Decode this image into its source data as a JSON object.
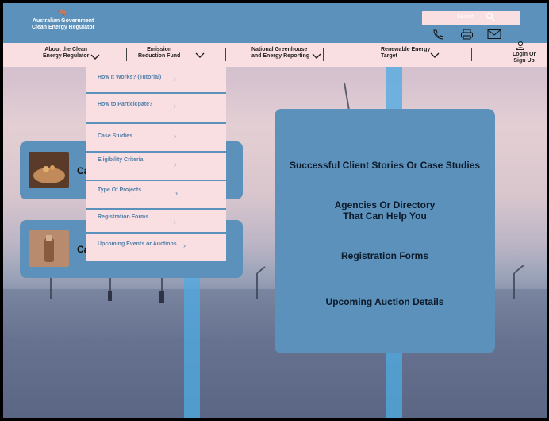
{
  "header": {
    "logo_line1": "Australian Government",
    "logo_line2": "Clean Energy Regulator",
    "search_placeholder": "Search",
    "icons": [
      "phone-icon",
      "printer-icon",
      "mail-icon"
    ]
  },
  "nav": {
    "items": [
      {
        "line1": "About the Clean",
        "line2": "Energy Regulator"
      },
      {
        "line1": "Emission",
        "line2": "Reduction Fund"
      },
      {
        "line1": "National Greenhouse",
        "line2": "and Energy Reporting"
      },
      {
        "line1": "Renewable Energy",
        "line2": "Target"
      }
    ],
    "login_line1": "Login Or",
    "login_line2": "Sign Up"
  },
  "dropdown": {
    "items": [
      "How It Works? (Tutorial)",
      "How to Particicpate?",
      "Case Studies",
      "Eligibility Criteria",
      "Type Of Projects",
      "Registration Forms",
      "Upcoming Events or Auctions"
    ]
  },
  "cards": [
    {
      "title_fragment": "Ca"
    },
    {
      "title_fragment": "Ca"
    }
  ],
  "panel": {
    "line1": "Successful Client Stories Or Case Studies",
    "line2a": "Agencies Or Directory",
    "line2b": "That Can Help You",
    "line3": "Registration Forms",
    "line4": "Upcoming Auction Details"
  },
  "colors": {
    "primary_blue": "#5b91bb",
    "pink": "#fadfe2",
    "stripe": "#4faae1"
  }
}
